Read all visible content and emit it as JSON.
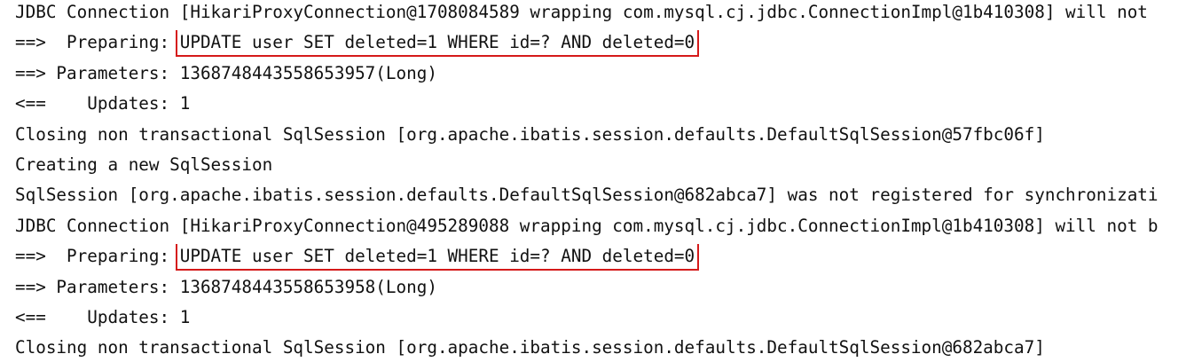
{
  "console": {
    "lines": [
      {
        "text": "JDBC Connection [HikariProxyConnection@1708084589 wrapping com.mysql.cj.jdbc.ConnectionImpl@1b410308] will not"
      },
      {
        "prefix": "==>  Preparing: ",
        "sql": "UPDATE user SET deleted=1 WHERE id=? AND deleted=0"
      },
      {
        "text": "==> Parameters: 1368748443558653957(Long)"
      },
      {
        "text": "<==    Updates: 1"
      },
      {
        "text": "Closing non transactional SqlSession [org.apache.ibatis.session.defaults.DefaultSqlSession@57fbc06f]"
      },
      {
        "text": "Creating a new SqlSession"
      },
      {
        "text": "SqlSession [org.apache.ibatis.session.defaults.DefaultSqlSession@682abca7] was not registered for synchronizati"
      },
      {
        "text": "JDBC Connection [HikariProxyConnection@495289088 wrapping com.mysql.cj.jdbc.ConnectionImpl@1b410308] will not b"
      },
      {
        "prefix": "==>  Preparing: ",
        "sql": "UPDATE user SET deleted=1 WHERE id=? AND deleted=0"
      },
      {
        "text": "==> Parameters: 1368748443558653958(Long)"
      },
      {
        "text": "<==    Updates: 1"
      },
      {
        "text": "Closing non transactional SqlSession [org.apache.ibatis.session.defaults.DefaultSqlSession@682abca7]"
      }
    ]
  },
  "highlight_color": "#d51a1a"
}
